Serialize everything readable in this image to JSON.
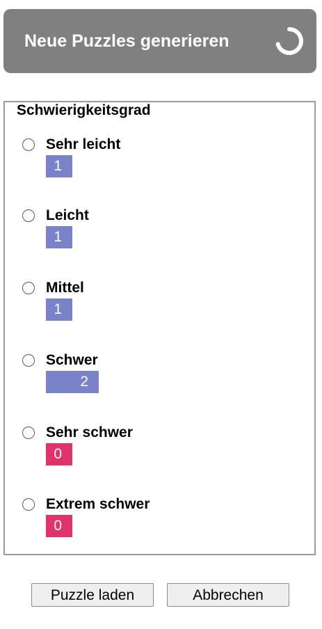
{
  "generate": {
    "label": "Neue Puzzles generieren",
    "icon": "loading-spinner-icon"
  },
  "difficulty": {
    "legend": "Schwierigkeitsgrad",
    "options": [
      {
        "label": "Sehr leicht",
        "count": "1",
        "color": "#7b83c8",
        "selected": false
      },
      {
        "label": "Leicht",
        "count": "1",
        "color": "#7b83c8",
        "selected": false
      },
      {
        "label": "Mittel",
        "count": "1",
        "color": "#7b83c8",
        "selected": false
      },
      {
        "label": "Schwer",
        "count": "2",
        "color": "#7b83c8",
        "selected": false
      },
      {
        "label": "Sehr schwer",
        "count": "0",
        "color": "#e0336a",
        "selected": false
      },
      {
        "label": "Extrem schwer",
        "count": "0",
        "color": "#e0336a",
        "selected": false
      }
    ]
  },
  "actions": {
    "load_label": "Puzzle laden",
    "cancel_label": "Abbrechen"
  },
  "colors": {
    "header_button_bg": "#808080",
    "count_available": "#7b83c8",
    "count_empty": "#e0336a"
  }
}
